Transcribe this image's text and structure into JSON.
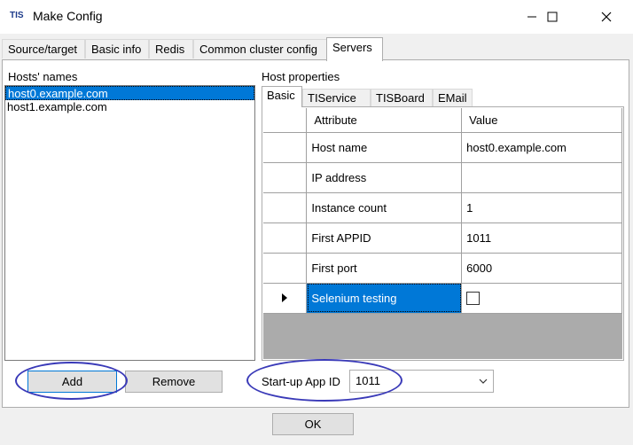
{
  "window": {
    "logo": "TIS",
    "title": "Make Config"
  },
  "tabs": [
    {
      "label": "Source/target"
    },
    {
      "label": "Basic info"
    },
    {
      "label": "Redis"
    },
    {
      "label": "Common cluster config"
    },
    {
      "label": "Servers"
    }
  ],
  "hosts": {
    "label": "Hosts' names",
    "items": [
      "host0.example.com",
      "host1.example.com"
    ],
    "selected_index": 0,
    "add_label": "Add",
    "remove_label": "Remove"
  },
  "properties": {
    "label": "Host properties",
    "tabs": [
      "Basic",
      "TIService",
      "TISBoard",
      "EMail"
    ],
    "grid": {
      "columns": [
        "Attribute",
        "Value"
      ],
      "rows": [
        {
          "attribute": "Host name",
          "value": "host0.example.com"
        },
        {
          "attribute": "IP address",
          "value": ""
        },
        {
          "attribute": "Instance count",
          "value": "1"
        },
        {
          "attribute": "First APPID",
          "value": "1011"
        },
        {
          "attribute": "First port",
          "value": "6000"
        },
        {
          "attribute": "Selenium testing",
          "value": ""
        }
      ]
    }
  },
  "startup": {
    "label": "Start-up App ID",
    "value": "1011"
  },
  "ok_label": "OK",
  "colors": {
    "accent": "#0078d7",
    "highlight_ellipse": "#3a3ab8"
  }
}
